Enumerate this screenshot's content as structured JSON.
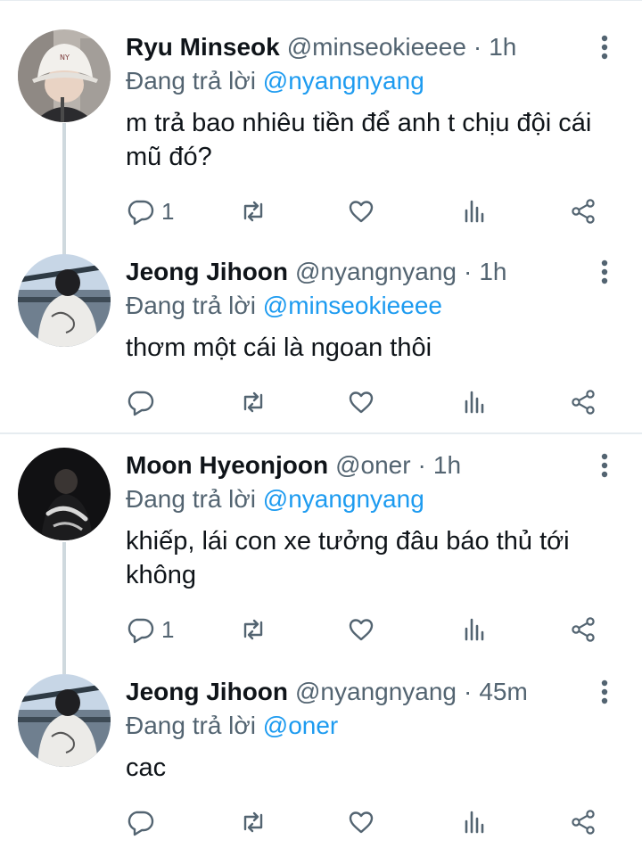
{
  "colors": {
    "text": "#0f1419",
    "secondary": "#536471",
    "link": "#1d9bf0",
    "divider": "#e6ecf0",
    "thread": "#cfd9de"
  },
  "icons": [
    "more-vertical-icon",
    "reply-icon",
    "retweet-icon",
    "like-icon",
    "stats-icon",
    "share-icon"
  ],
  "tweets": [
    {
      "name": "Ryu Minseok",
      "handle": "@minseokieeee",
      "separator": "·",
      "time": "1h",
      "reply_prefix": "Đang trả lời",
      "reply_to": "@nyangnyang",
      "text": "m trả bao nhiêu tiền để anh t chịu đội cái mũ đó?",
      "reply_count": "1"
    },
    {
      "name": "Jeong Jihoon",
      "handle": "@nyangnyang",
      "separator": "·",
      "time": "1h",
      "reply_prefix": "Đang trả lời",
      "reply_to": "@minseokieeee",
      "text": "thơm một cái là ngoan thôi",
      "reply_count": ""
    },
    {
      "name": "Moon Hyeonjoon",
      "handle": "@oner",
      "separator": "·",
      "time": "1h",
      "reply_prefix": "Đang trả lời",
      "reply_to": "@nyangnyang",
      "text": "khiếp, lái con xe tưởng đâu báo thủ tới không",
      "reply_count": "1"
    },
    {
      "name": "Jeong Jihoon",
      "handle": "@nyangnyang",
      "separator": "·",
      "time": "45m",
      "reply_prefix": "Đang trả lời",
      "reply_to": "@oner",
      "text": "cac",
      "reply_count": ""
    }
  ]
}
